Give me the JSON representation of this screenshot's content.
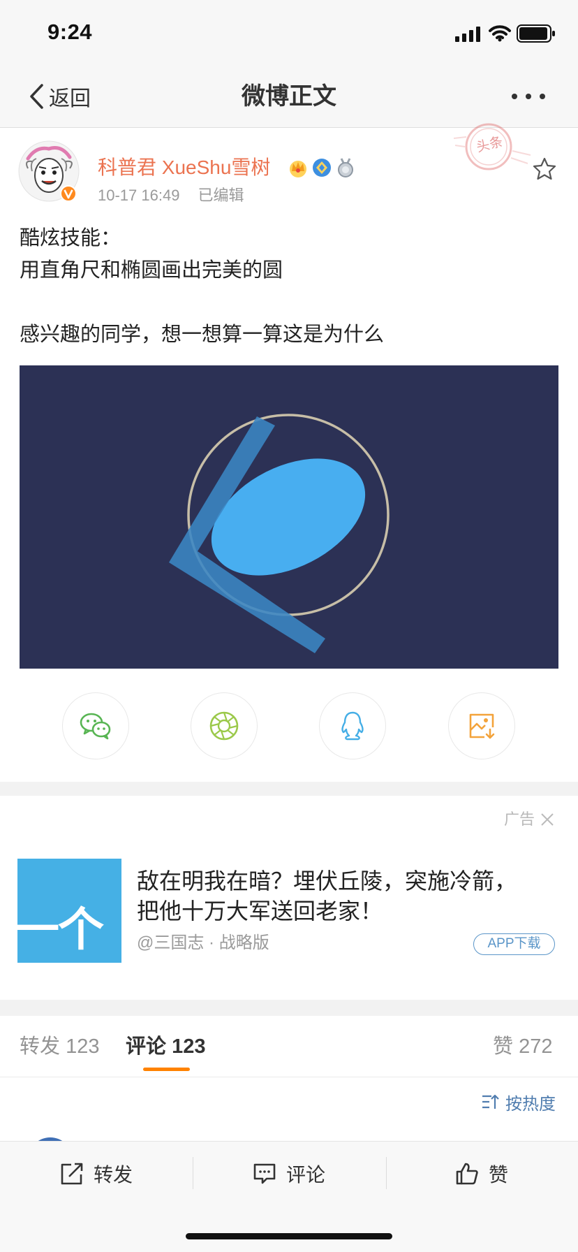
{
  "status_bar": {
    "time": "9:24"
  },
  "nav": {
    "back_label": "返回",
    "title": "微博正文"
  },
  "post": {
    "author": "科普君 XueShu雪树",
    "timestamp": "10-17 16:49",
    "edited_label": "已编辑",
    "stamp_text": "头条",
    "text_lines": [
      "酷炫技能：",
      "用直角尺和椭圆画出完美的圆",
      "",
      "感兴趣的同学，想一想算一算这是为什么"
    ],
    "badges": [
      "crown-badge-icon",
      "blue-badge-icon",
      "silver-medal-icon"
    ]
  },
  "share_buttons": [
    {
      "icon": "wechat-icon"
    },
    {
      "icon": "moments-icon"
    },
    {
      "icon": "qq-icon"
    },
    {
      "icon": "save-image-icon"
    }
  ],
  "ad": {
    "label": "广告",
    "image_text": "一个",
    "title_lines": [
      "敌在明我在暗？埋伏丘陵，突施冷箭，",
      "把他十万大军送回老家！"
    ],
    "source": "@三国志 · 战略版",
    "button_label": "APP下载"
  },
  "tabs": [
    {
      "label": "转发",
      "count": "123",
      "active": false
    },
    {
      "label": "评论",
      "count": "123",
      "active": true
    },
    {
      "label": "赞",
      "count": "272",
      "active": false
    }
  ],
  "sort_label": "按热度",
  "action_bar": [
    {
      "label": "转发",
      "icon": "repost-icon"
    },
    {
      "label": "评论",
      "icon": "comment-icon"
    },
    {
      "label": "赞",
      "icon": "like-icon"
    }
  ],
  "colors": {
    "author": "#eb7350",
    "active_tab_underline": "#ff8200",
    "image_background": "#2c3155",
    "ellipse": "#48aef0",
    "link_blue": "#507daf"
  }
}
